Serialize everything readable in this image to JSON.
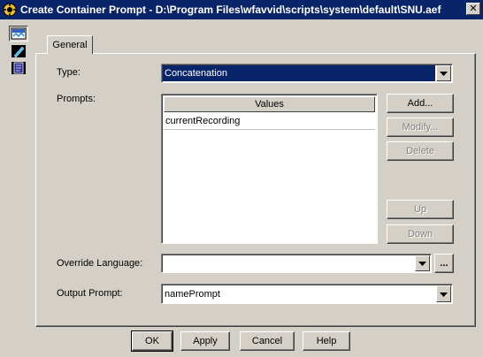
{
  "window": {
    "title": "Create Container Prompt - D:\\Program Files\\wfavvid\\scripts\\system\\default\\SNU.aef",
    "close_label": "✕"
  },
  "tabs": [
    {
      "label": "General"
    }
  ],
  "form": {
    "type_label": "Type:",
    "type_value": "Concatenation",
    "prompts_label": "Prompts:",
    "values_header": "Values",
    "prompt_rows": [
      "currentRecording"
    ],
    "override_language_label": "Override Language:",
    "override_language_value": "",
    "output_prompt_label": "Output Prompt:",
    "output_prompt_value": "namePrompt"
  },
  "side_buttons": {
    "add": "Add...",
    "modify": "Modify...",
    "delete": "Delete",
    "up": "Up",
    "down": "Down"
  },
  "browse_label": "...",
  "footer": {
    "ok": "OK",
    "apply": "Apply",
    "cancel": "Cancel",
    "help": "Help"
  },
  "colors": {
    "titlebar": "#0a246a",
    "face": "#d4d0c8",
    "selection": "#0a246a"
  }
}
